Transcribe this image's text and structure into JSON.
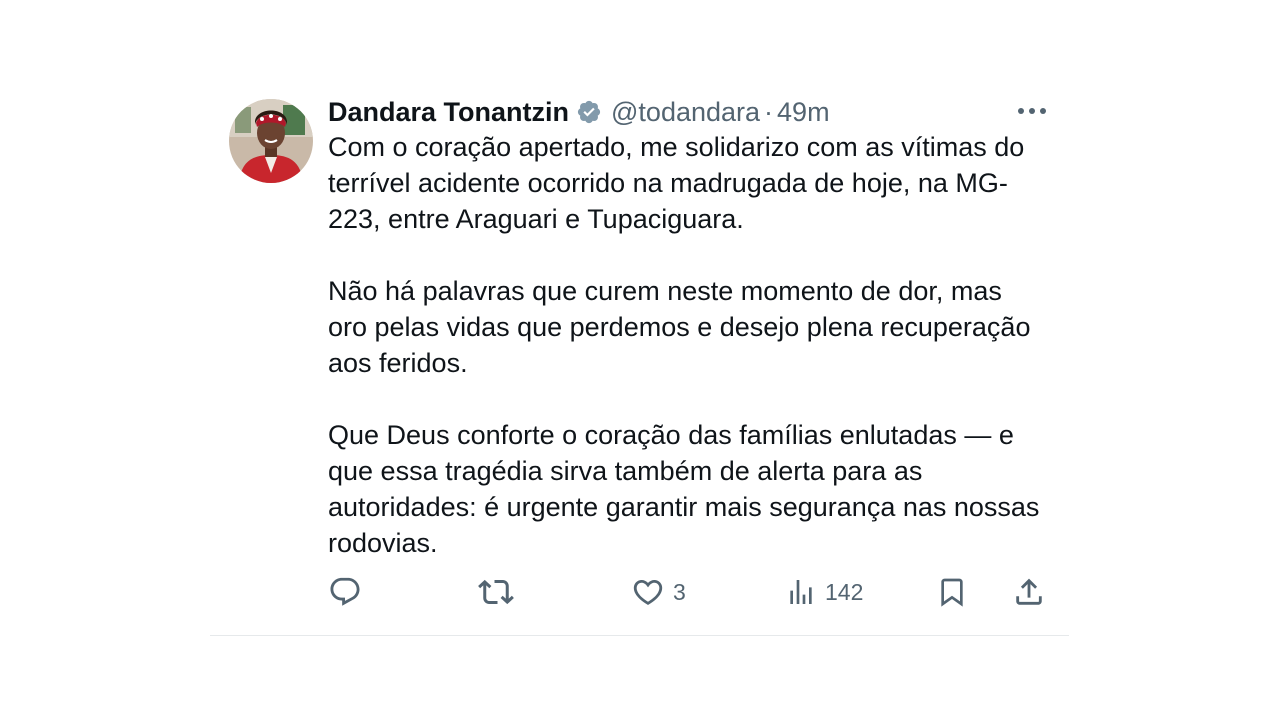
{
  "tweet": {
    "author_name": "Dandara Tonantzin",
    "handle": "@todandara",
    "separator": "·",
    "time": "49m",
    "paragraphs": [
      "Com o coração apertado, me solidarizo com as vítimas do terrível acidente ocorrido na madrugada de hoje, na MG-223, entre Araguari e Tupaciguara.",
      "Não há palavras que curem neste momento de dor, mas oro pelas vidas que perdemos e desejo plena recuperação aos feridos.",
      "Que Deus conforte o coração das famílias enlutadas — e que essa tragédia sirva também de alerta para as autoridades: é urgente garantir mais segurança nas nossas rodovias."
    ],
    "likes": "3",
    "views": "142"
  },
  "icons": {
    "verified": "verified-badge-icon",
    "more": "more-options-icon",
    "reply": "reply-icon",
    "retweet": "retweet-icon",
    "like": "heart-icon",
    "views": "views-chart-icon",
    "bookmark": "bookmark-icon",
    "share": "share-icon"
  },
  "colors": {
    "text": "#0f1419",
    "secondary": "#536471",
    "verified_badge": "#829aab",
    "divider": "#e6e9eb"
  }
}
